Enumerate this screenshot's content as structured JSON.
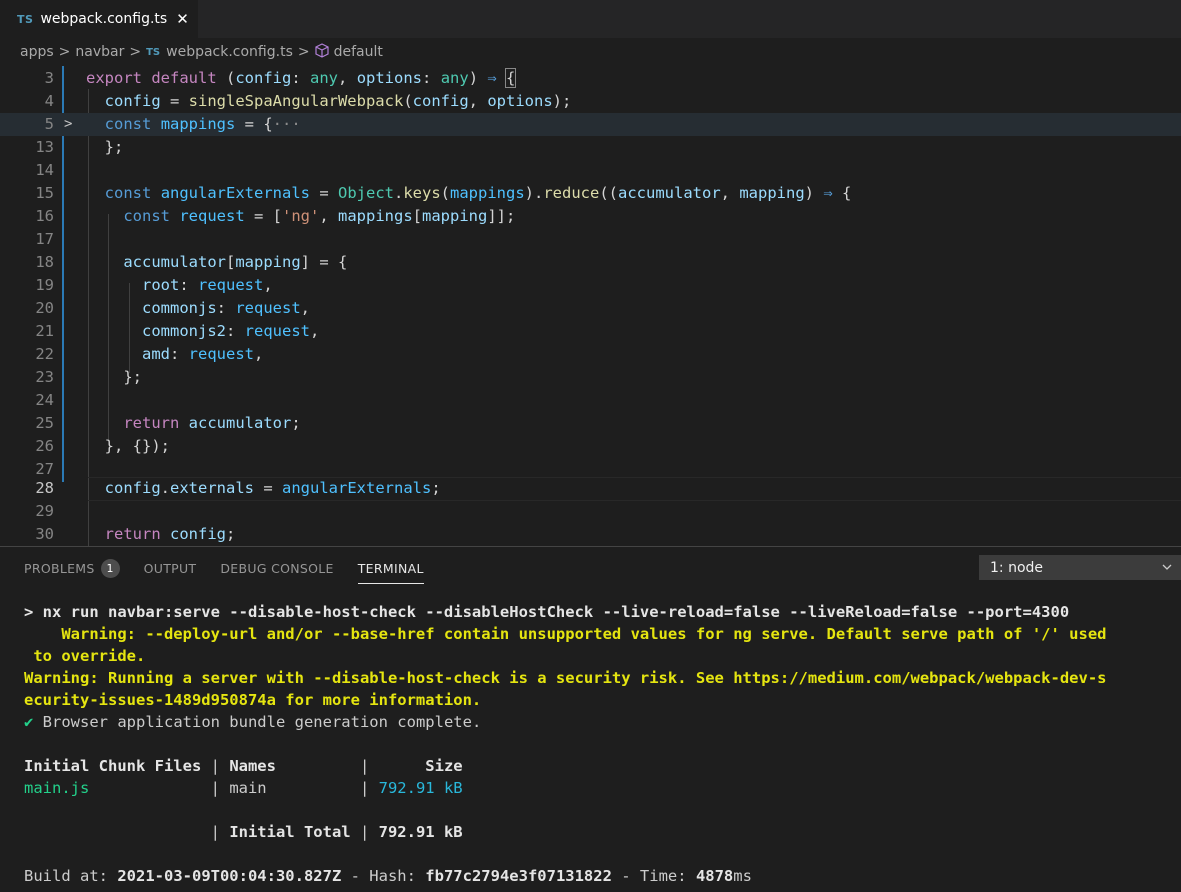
{
  "tab": {
    "badge": "TS",
    "title": "webpack.config.ts",
    "close": "✕"
  },
  "breadcrumb": {
    "items": [
      "apps",
      "navbar",
      "webpack.config.ts",
      "default"
    ],
    "ts_badge": "TS",
    "sep": ">"
  },
  "editor": {
    "line_numbers": [
      "3",
      "4",
      "5",
      "13",
      "14",
      "15",
      "16",
      "17",
      "18",
      "19",
      "20",
      "21",
      "22",
      "23",
      "24",
      "25",
      "26",
      "27",
      "28",
      "29",
      "30"
    ],
    "fold_glyph": ">",
    "fold_dots": "···"
  },
  "panel": {
    "tabs": [
      "PROBLEMS",
      "OUTPUT",
      "DEBUG CONSOLE",
      "TERMINAL"
    ],
    "problems_count": "1",
    "terminal_select": "1: node"
  },
  "terminal": {
    "cmd": "> nx run navbar:serve --disable-host-check --disableHostCheck --live-reload=false --liveReload=false --port=4300",
    "warn1a": "    Warning: --deploy-url and/or --base-href contain unsupported values for ng serve. Default serve path of '/' used",
    "warn1b": " to override.",
    "warn2a": "Warning: Running a server with --disable-host-check is a security risk. See https://medium.com/webpack/webpack-dev-s",
    "warn2b": "ecurity-issues-1489d950874a for more information.",
    "check": "✔",
    "bundle": " Browser application bundle generation complete.",
    "table_header": [
      "Initial Chunk Files",
      "Names",
      "Size"
    ],
    "row_file": "main.js",
    "row_name": "main",
    "row_size": "792.91 kB",
    "total_label": "Initial Total",
    "total_size": "792.91 kB",
    "build_label": "Build at: ",
    "build_time": "2021-03-09T00:04:30.827Z",
    "hash_label": " - Hash: ",
    "hash": "fb77c2794e3f07131822",
    "time_label": " - Time: ",
    "time": "4878",
    "time_unit": "ms"
  }
}
